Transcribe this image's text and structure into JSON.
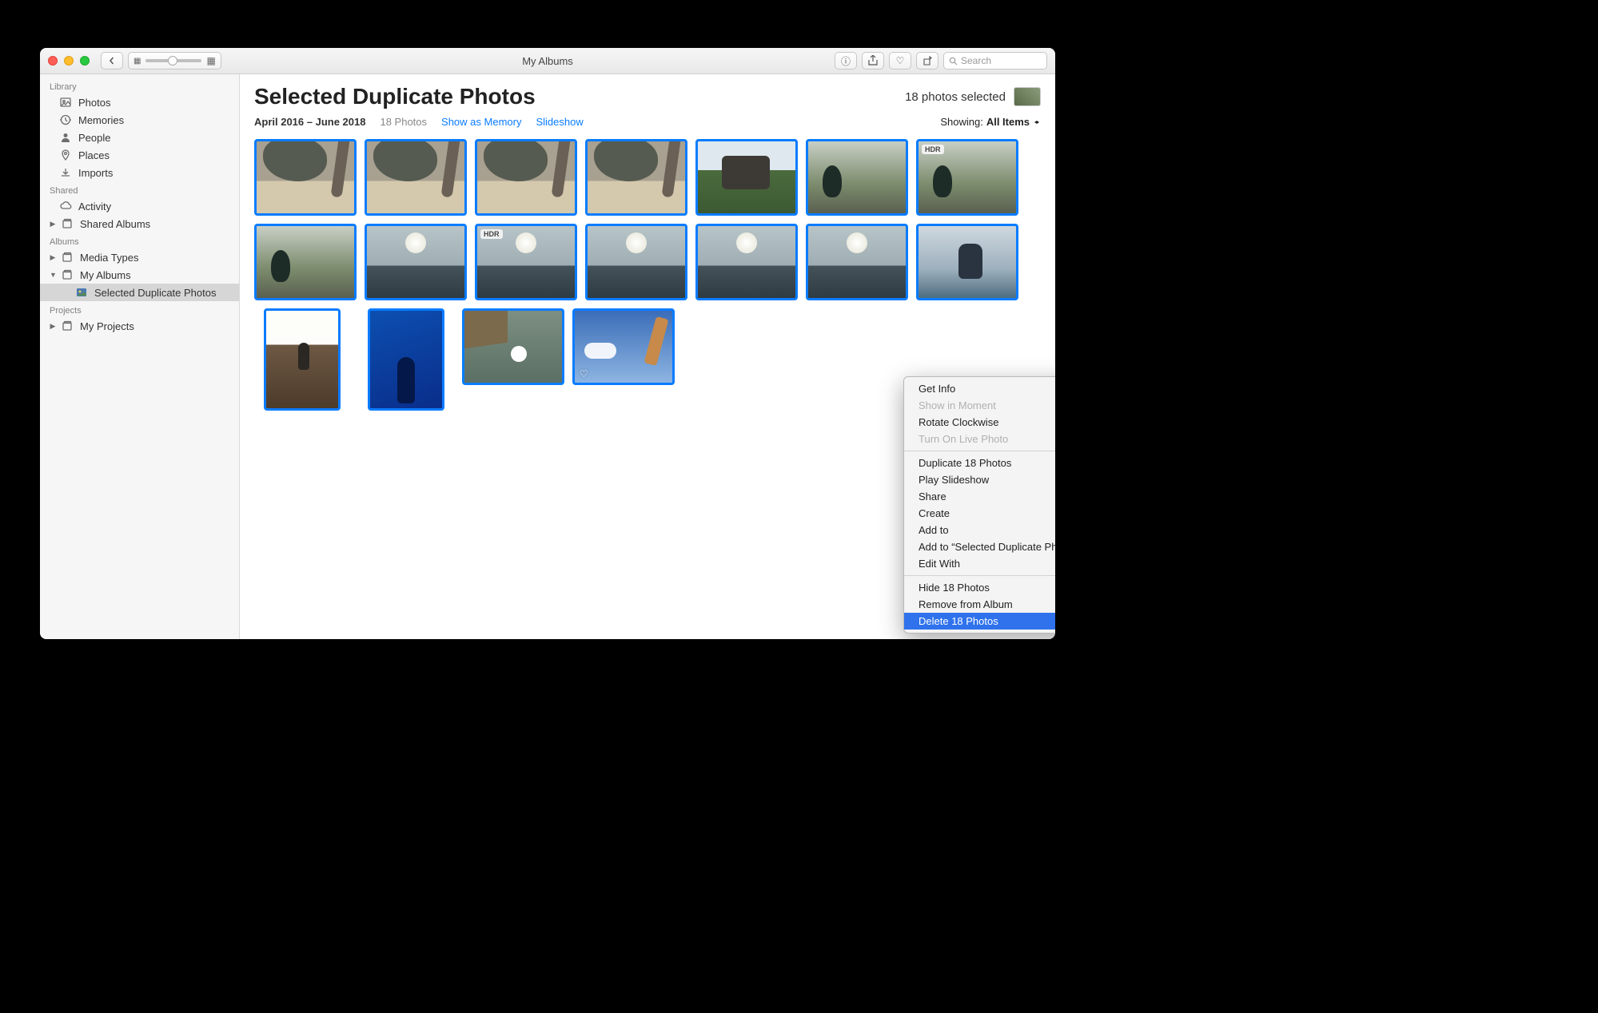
{
  "window": {
    "title": "My Albums"
  },
  "toolbar": {
    "search_placeholder": "Search"
  },
  "sidebar": {
    "sections": {
      "library": "Library",
      "shared": "Shared",
      "albums": "Albums",
      "projects": "Projects"
    },
    "library_items": [
      {
        "label": "Photos",
        "icon": "photos"
      },
      {
        "label": "Memories",
        "icon": "memories"
      },
      {
        "label": "People",
        "icon": "people"
      },
      {
        "label": "Places",
        "icon": "places"
      },
      {
        "label": "Imports",
        "icon": "imports"
      }
    ],
    "shared_items": [
      {
        "label": "Activity",
        "icon": "cloud"
      },
      {
        "label": "Shared Albums",
        "icon": "album",
        "disclosure": true
      }
    ],
    "albums_items": [
      {
        "label": "Media Types",
        "icon": "album",
        "disclosure": true,
        "expanded": false
      },
      {
        "label": "My Albums",
        "icon": "album",
        "disclosure": true,
        "expanded": true,
        "children": [
          {
            "label": "Selected Duplicate Photos",
            "selected": true
          }
        ]
      }
    ],
    "projects_items": [
      {
        "label": "My Projects",
        "icon": "album",
        "disclosure": true
      }
    ]
  },
  "header": {
    "album_title": "Selected Duplicate Photos",
    "selection_text": "18 photos selected",
    "date_range": "April 2016 – June 2018",
    "photo_count": "18 Photos",
    "show_memory": "Show as Memory",
    "slideshow": "Slideshow",
    "showing_label": "Showing:",
    "showing_value": "All Items"
  },
  "photos": [
    {
      "kind": "beach"
    },
    {
      "kind": "beach"
    },
    {
      "kind": "beach"
    },
    {
      "kind": "beach"
    },
    {
      "kind": "bush"
    },
    {
      "kind": "peacock"
    },
    {
      "kind": "peacock",
      "badge": "HDR"
    },
    {
      "kind": "peacock"
    },
    {
      "kind": "ocean"
    },
    {
      "kind": "ocean",
      "badge": "HDR"
    },
    {
      "kind": "ocean"
    },
    {
      "kind": "ocean"
    },
    {
      "kind": "ocean"
    },
    {
      "kind": "boat"
    },
    {
      "kind": "stairs",
      "orient": "portrait"
    },
    {
      "kind": "aqua",
      "orient": "portrait"
    },
    {
      "kind": "duck"
    },
    {
      "kind": "sky",
      "favorite": true
    }
  ],
  "context_menu": {
    "groups": [
      [
        {
          "label": "Get Info"
        },
        {
          "label": "Show in Moment",
          "disabled": true
        },
        {
          "label": "Rotate Clockwise"
        },
        {
          "label": "Turn On Live Photo",
          "disabled": true
        }
      ],
      [
        {
          "label": "Duplicate 18 Photos"
        },
        {
          "label": "Play Slideshow"
        },
        {
          "label": "Share",
          "submenu": true
        },
        {
          "label": "Create",
          "submenu": true
        },
        {
          "label": "Add to",
          "submenu": true
        },
        {
          "label": "Add to “Selected Duplicate Photos”"
        },
        {
          "label": "Edit With",
          "submenu": true
        }
      ],
      [
        {
          "label": "Hide 18 Photos"
        },
        {
          "label": "Remove from Album"
        },
        {
          "label": "Delete 18 Photos",
          "highlighted": true
        }
      ]
    ]
  }
}
